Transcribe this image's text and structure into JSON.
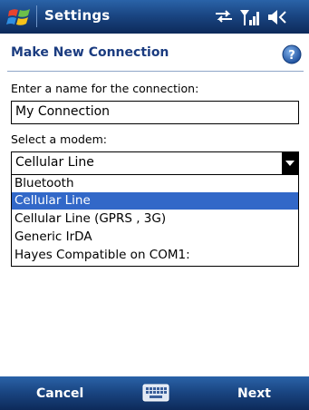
{
  "titlebar": {
    "app_title": "Settings",
    "icons": [
      "windows-start-icon",
      "sync-icon",
      "signal-icon",
      "volume-icon"
    ]
  },
  "header": {
    "title": "Make New Connection",
    "help_icon": "help-icon"
  },
  "form": {
    "name_label": "Enter a name for the connection:",
    "name_value": "My Connection",
    "modem_label": "Select a modem:",
    "modem_selected": "Cellular Line",
    "modem_options": [
      "Bluetooth",
      "Cellular Line",
      "Cellular Line (GPRS , 3G)",
      "Generic IrDA",
      "Hayes Compatible on COM1:"
    ],
    "highlighted_option_index": 1
  },
  "softkeys": {
    "left_label": "Cancel",
    "right_label": "Next",
    "center_icon": "keyboard-icon"
  },
  "colors": {
    "titlebar": "#1a4683",
    "page_title": "#1b3c80",
    "selection": "#3268c8"
  }
}
